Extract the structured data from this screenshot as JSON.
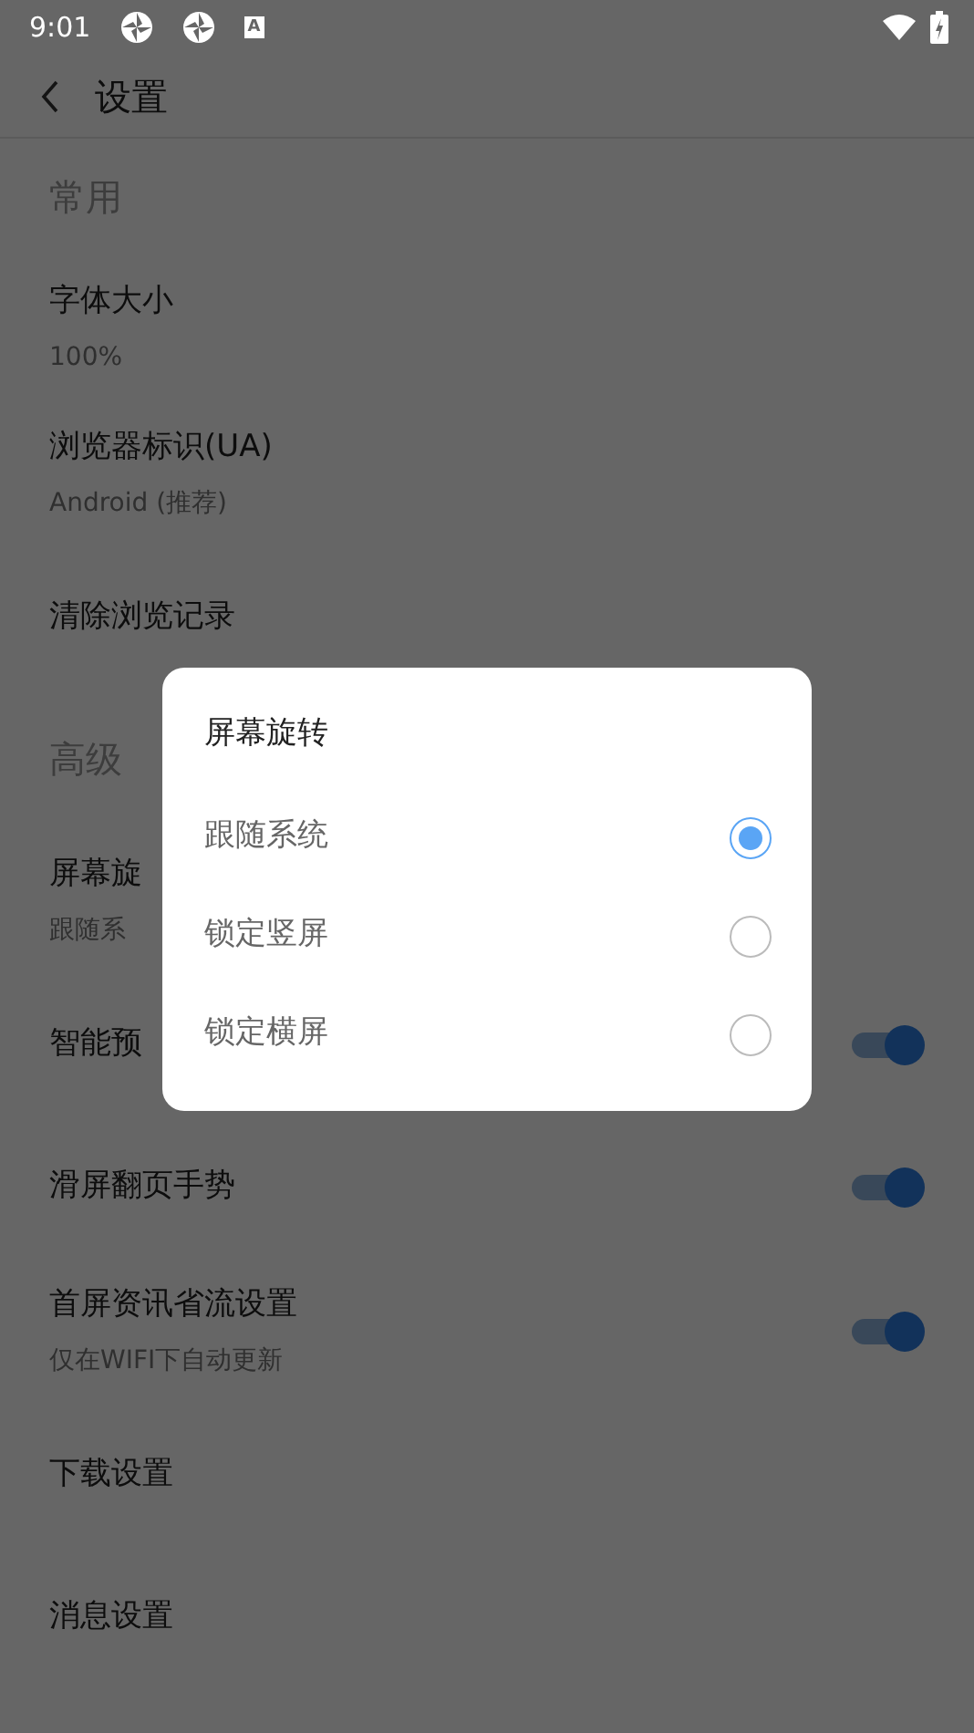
{
  "status_bar": {
    "time": "9:01",
    "badge_letter": "A"
  },
  "header": {
    "title": "设置"
  },
  "settings": [
    {
      "kind": "section",
      "title": "常用"
    },
    {
      "kind": "row",
      "title": "字体大小",
      "subtitle": "100%"
    },
    {
      "kind": "row",
      "title": "浏览器标识(UA)",
      "subtitle": "Android (推荐)"
    },
    {
      "kind": "row",
      "title": "清除浏览记录"
    },
    {
      "kind": "section",
      "title": "高级"
    },
    {
      "kind": "row",
      "title": "屏幕旋",
      "subtitle": "跟随系"
    },
    {
      "kind": "toggle",
      "title": "智能预",
      "on": true
    },
    {
      "kind": "toggle",
      "title": "滑屏翻页手势",
      "on": true
    },
    {
      "kind": "toggle",
      "title": "首屏资讯省流设置",
      "subtitle": "仅在WIFI下自动更新",
      "on": true
    },
    {
      "kind": "row",
      "title": "下载设置"
    },
    {
      "kind": "row",
      "title": "消息设置"
    }
  ],
  "dialog": {
    "title": "屏幕旋转",
    "options": [
      {
        "label": "跟随系统",
        "selected": true
      },
      {
        "label": "锁定竖屏",
        "selected": false
      },
      {
        "label": "锁定横屏",
        "selected": false
      }
    ]
  }
}
